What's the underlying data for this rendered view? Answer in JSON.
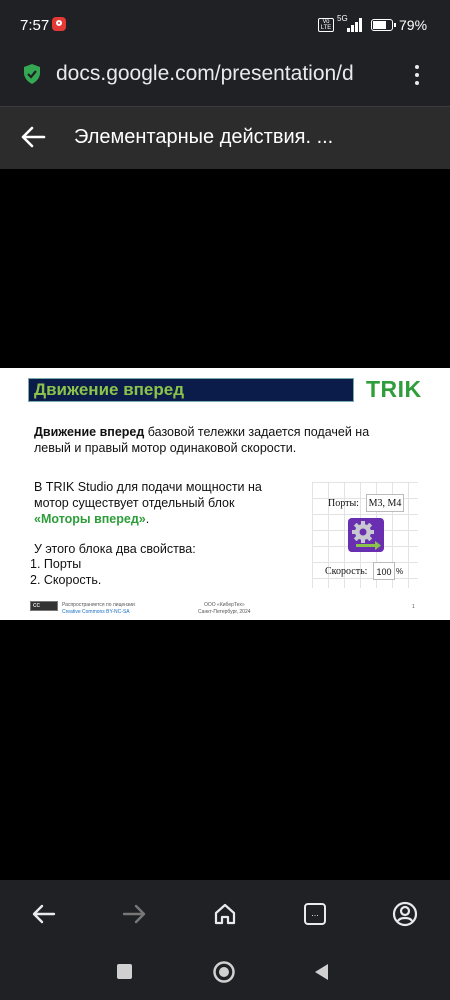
{
  "status_bar": {
    "time": "7:57",
    "network": "5G",
    "volte": "Vo LTE",
    "battery_percent": "79%",
    "battery_level": 0.79
  },
  "browser": {
    "url": "docs.google.com/presentation/d",
    "security_icon": "shield-check-icon",
    "menu_icon": "kebab-menu-icon"
  },
  "toolbar": {
    "back_icon": "arrow-left-icon",
    "title": "Элементарные действия. ..."
  },
  "slide": {
    "heading": "Движение вперед",
    "logo": "TRIK",
    "p1_bold": "Движение вперед",
    "p1_rest": " базовой тележки задается подачей на левый и правый мотор одинаковой скорости.",
    "p2_text": "В TRIK Studio для подачи мощности на мотор существует отдельный блок ",
    "p2_highlight": "«Моторы вперед»",
    "p2_end": ".",
    "p3": "У этого блока два свойства:",
    "list": [
      "1.   Порты",
      "2.   Скорость."
    ],
    "panel": {
      "ports_label": "Порты:",
      "ports_value": "M3, M4",
      "speed_label": "Скорость:",
      "speed_value": "100",
      "speed_unit": "%",
      "block_icon": "gear-motor-icon"
    },
    "footer": {
      "license_line1": "Распространяется по лицензии",
      "license_line2": "Creative Commons BY-NC-SA",
      "org_line1": "ООО «КиберТех»",
      "org_line2": "Санкт-Петербург, 2024",
      "page": "1"
    }
  },
  "bottom_nav": {
    "icons": [
      "arrow-back-icon",
      "arrow-forward-icon",
      "home-icon",
      "tabs-icon",
      "account-icon"
    ],
    "tabs_label": "..."
  },
  "system_nav": {
    "icons": [
      "recents-square-icon",
      "home-circle-icon",
      "back-triangle-icon"
    ]
  },
  "colors": {
    "chrome_bg": "#202124",
    "toolbar_bg": "#2c2c2c",
    "heading_bg": "#0b1c4a",
    "heading_text": "#8bc34a",
    "brand_green": "#2e9d3a",
    "shield_green": "#34a853",
    "block_purple": "#6a2fb0"
  }
}
